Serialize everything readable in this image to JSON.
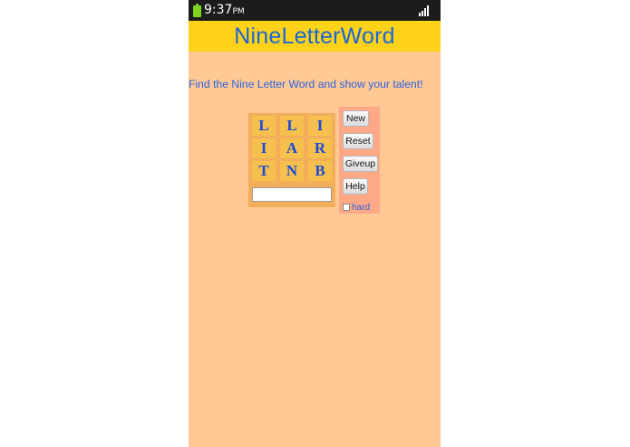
{
  "status_bar": {
    "time": "9:37",
    "ampm": "PM",
    "battery_icon": "battery-icon",
    "signal_icon": "signal-icon"
  },
  "app": {
    "title": "NineLetterWord",
    "tagline": "Find the Nine Letter Word and show your talent!"
  },
  "board": {
    "letters": [
      "L",
      "L",
      "I",
      "I",
      "A",
      "R",
      "T",
      "N",
      "B"
    ],
    "answer_value": ""
  },
  "controls": {
    "new_label": "New",
    "reset_label": "Reset",
    "giveup_label": "Giveup",
    "help_label": "Help",
    "hard_label": "hard",
    "hard_checked": false
  },
  "colors": {
    "background": "#ffc895",
    "title_bar": "#ffd21a",
    "accent_blue": "#1a66d6",
    "tile": "#f5c04d",
    "board": "#f4ad58",
    "controls_panel": "#ffa885"
  }
}
